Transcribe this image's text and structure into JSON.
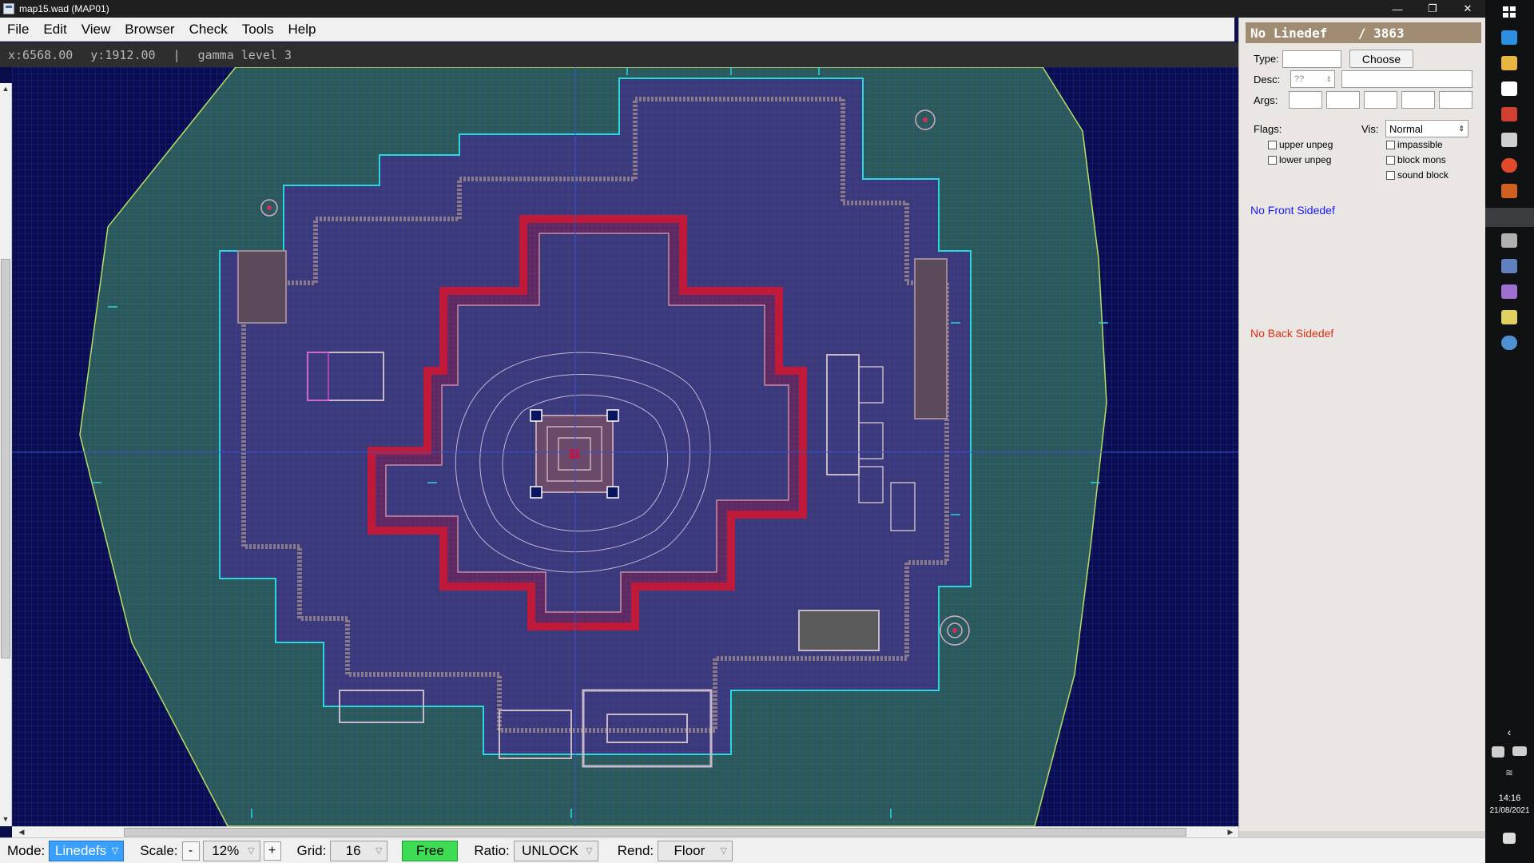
{
  "window": {
    "title": "map15.wad (MAP01)",
    "controls": [
      "—",
      "❐",
      "✕"
    ]
  },
  "menu": [
    {
      "label": "File",
      "mnemonic": "F"
    },
    {
      "label": "Edit",
      "mnemonic": "E"
    },
    {
      "label": "View",
      "mnemonic": "V"
    },
    {
      "label": "Browser",
      "mnemonic": "B"
    },
    {
      "label": "Check",
      "mnemonic": "C"
    },
    {
      "label": "Tools",
      "mnemonic": "T"
    },
    {
      "label": "Help",
      "mnemonic": "H"
    }
  ],
  "status": {
    "x": "x:6568.00",
    "y": "y:1912.00",
    "sep": "|",
    "gamma": "gamma level 3"
  },
  "panel": {
    "header": "No Linedef    / 3863",
    "type_label": "Type:",
    "choose_label": "Choose",
    "desc_label": "Desc:",
    "desc_spinner": "??",
    "args_label": "Args:",
    "flags_label": "Flags:",
    "vis_label": "Vis:",
    "vis_value": "Normal",
    "flags_left": [
      "upper unpeg",
      "lower unpeg"
    ],
    "flags_right": [
      "impassible",
      "block mons",
      "sound block"
    ],
    "front_sidedef": "No Front Sidedef",
    "back_sidedef": "No Back Sidedef"
  },
  "toolbar": {
    "mode_label": "Mode:",
    "mode_value": "Linedefs",
    "scale_label": "Scale:",
    "scale_minus": "-",
    "scale_value": "12%",
    "scale_plus": "+",
    "grid_label": "Grid:",
    "grid_value": "16",
    "free_label": "Free",
    "ratio_label": "Ratio:",
    "ratio_value": "UNLOCK",
    "rend_label": "Rend:",
    "rend_value": "Floor"
  },
  "taskbar": {
    "time": "14:16",
    "date": "21/08/2021"
  },
  "colors": {
    "map_background": "#0a0d4f",
    "outer_area": "#2f5a5a",
    "inner_area": "#3a3a7a",
    "cyan_lines": "#2ad8e0",
    "red_lines": "#c01a3a",
    "selected_vertex": "#0a1560",
    "mode_blue": "#3aa0ff",
    "free_green": "#3ddc52",
    "panel_header": "#a08c72",
    "front_sidedef_text": "#1a1aff",
    "back_sidedef_text": "#e03010"
  }
}
